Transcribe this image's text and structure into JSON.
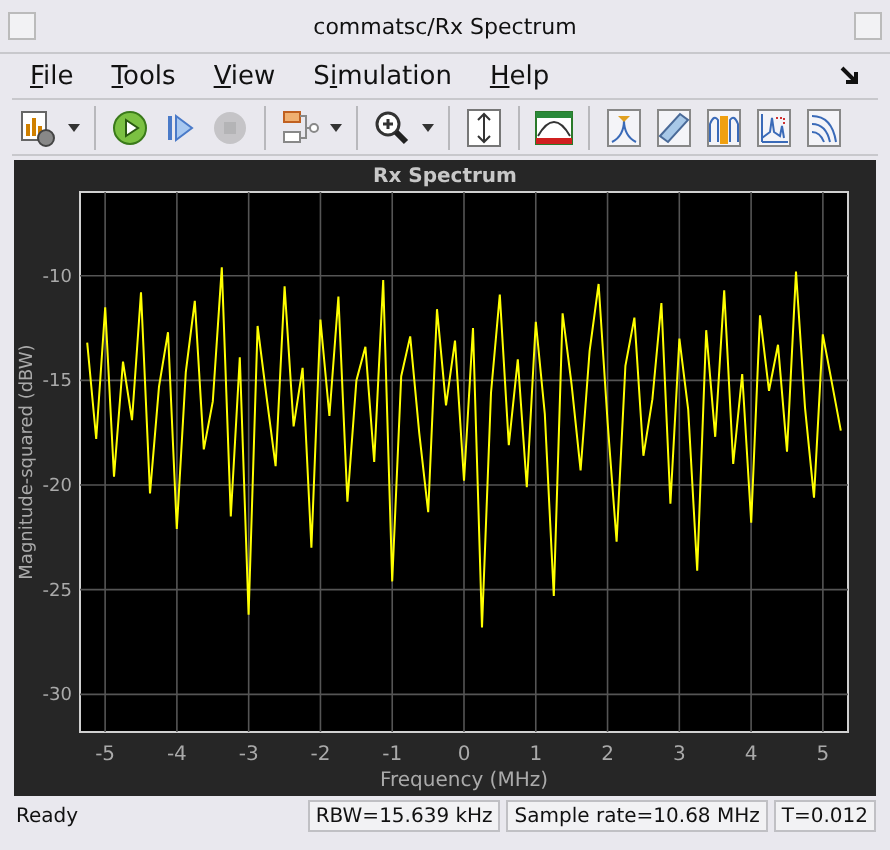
{
  "window": {
    "title": "commatsc/Rx Spectrum"
  },
  "menu": [
    {
      "underlined": "F",
      "rest": "ile"
    },
    {
      "underlined": "T",
      "rest": "ools"
    },
    {
      "underlined": "V",
      "rest": "iew"
    },
    {
      "lead": "S",
      "underlined": "i",
      "rest": "mulation"
    },
    {
      "underlined": "H",
      "rest": "elp"
    }
  ],
  "toolbar": [
    [
      {
        "kind": "settings",
        "dropdown": true,
        "disabled": false
      }
    ],
    [
      {
        "kind": "run",
        "dropdown": false,
        "disabled": false
      },
      {
        "kind": "step",
        "dropdown": false,
        "disabled": false
      },
      {
        "kind": "stop",
        "dropdown": false,
        "disabled": true
      }
    ],
    [
      {
        "kind": "highlight",
        "dropdown": true,
        "disabled": false
      }
    ],
    [
      {
        "kind": "zoom",
        "dropdown": true,
        "disabled": false
      }
    ],
    [
      {
        "kind": "autoscale",
        "dropdown": false,
        "disabled": false
      }
    ],
    [
      {
        "kind": "style",
        "dropdown": false,
        "disabled": false
      }
    ],
    [
      {
        "kind": "peak",
        "dropdown": false,
        "disabled": false
      },
      {
        "kind": "ruler",
        "dropdown": false,
        "disabled": false
      },
      {
        "kind": "channel",
        "dropdown": false,
        "disabled": false
      },
      {
        "kind": "distortion",
        "dropdown": false,
        "disabled": false
      },
      {
        "kind": "ccdf",
        "dropdown": false,
        "disabled": false
      }
    ]
  ],
  "plot": {
    "chart_data": {
      "type": "line",
      "title": "Rx Spectrum",
      "xlabel": "Frequency (MHz)",
      "ylabel": "Magnitude-squared (dBW)",
      "x": [
        -5.25,
        -5.125,
        -5,
        -4.875,
        -4.75,
        -4.625,
        -4.5,
        -4.375,
        -4.25,
        -4.125,
        -4,
        -3.875,
        -3.75,
        -3.625,
        -3.5,
        -3.375,
        -3.25,
        -3.125,
        -3,
        -2.875,
        -2.75,
        -2.625,
        -2.5,
        -2.375,
        -2.25,
        -2.125,
        -2,
        -1.875,
        -1.75,
        -1.625,
        -1.5,
        -1.375,
        -1.25,
        -1.125,
        -1,
        -0.875,
        -0.75,
        -0.625,
        -0.5,
        -0.375,
        -0.25,
        -0.125,
        0,
        0.125,
        0.25,
        0.375,
        0.5,
        0.625,
        0.75,
        0.875,
        1,
        1.125,
        1.25,
        1.375,
        1.5,
        1.625,
        1.75,
        1.875,
        2,
        2.125,
        2.25,
        2.375,
        2.5,
        2.625,
        2.75,
        2.875,
        3,
        3.125,
        3.25,
        3.375,
        3.5,
        3.625,
        3.75,
        3.875,
        4,
        4.125,
        4.25,
        4.375,
        4.5,
        4.625,
        4.75,
        4.875,
        5,
        5.125,
        5.25
      ],
      "series": [
        {
          "color": "#ffff00",
          "values": [
            -13.2,
            -17.8,
            -11.5,
            -19.6,
            -14.1,
            -16.9,
            -10.8,
            -20.4,
            -15.3,
            -12.7,
            -22.1,
            -14.6,
            -11.2,
            -18.3,
            -16.0,
            -9.6,
            -21.5,
            -13.9,
            -26.2,
            -12.4,
            -15.8,
            -19.1,
            -10.5,
            -17.2,
            -14.4,
            -23.0,
            -12.1,
            -16.7,
            -11.0,
            -20.8,
            -15.0,
            -13.4,
            -18.9,
            -10.2,
            -24.6,
            -14.8,
            -12.9,
            -17.5,
            -21.3,
            -11.6,
            -16.2,
            -13.1,
            -19.8,
            -12.5,
            -26.8,
            -15.6,
            -10.9,
            -18.1,
            -14.0,
            -20.1,
            -12.2,
            -16.6,
            -25.3,
            -11.8,
            -15.2,
            -19.3,
            -13.6,
            -10.4,
            -17.0,
            -22.7,
            -14.3,
            -12.0,
            -18.6,
            -15.9,
            -11.3,
            -20.9,
            -13.0,
            -16.4,
            -24.1,
            -12.6,
            -17.7,
            -10.7,
            -19.0,
            -14.7,
            -21.8,
            -11.9,
            -15.5,
            -13.3,
            -18.4,
            -9.8,
            -16.3,
            -20.6,
            -12.8,
            -15.1,
            -17.4
          ]
        }
      ],
      "xlim": [
        -5.35,
        5.35
      ],
      "ylim": [
        -31.8,
        -6
      ],
      "xticks": [
        -5,
        -4,
        -3,
        -2,
        -1,
        0,
        1,
        2,
        3,
        4,
        5
      ],
      "yticks": [
        -30,
        -25,
        -20,
        -15,
        -10
      ],
      "grid": true
    }
  },
  "status_bar": [
    "Ready",
    "RBW=15.639 kHz",
    "Sample rate=10.68 MHz",
    "T=0.012"
  ]
}
